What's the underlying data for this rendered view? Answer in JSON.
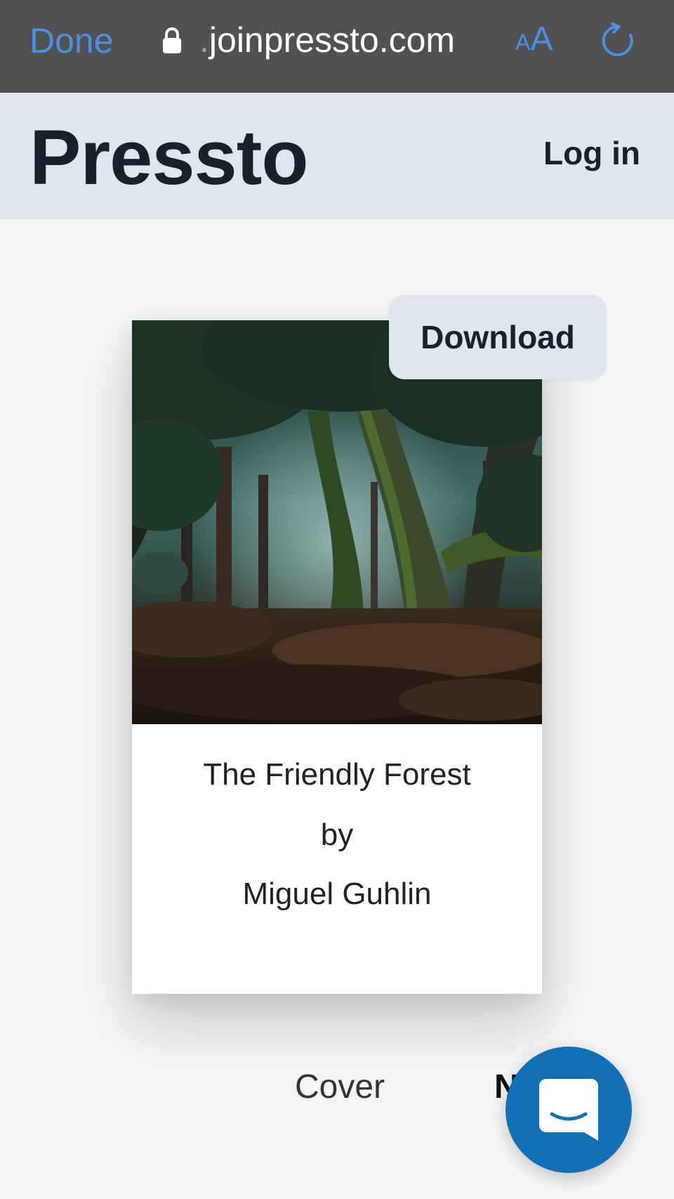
{
  "browser": {
    "done_label": "Done",
    "url_prefix": ".",
    "url": "joinpressto.com",
    "text_size_small": "A",
    "text_size_big": "A",
    "accent_color": "#4a90e2"
  },
  "header": {
    "brand": "Pressto",
    "login_label": "Log in",
    "background_color": "#dfe6ef"
  },
  "book": {
    "download_label": "Download",
    "title": "The Friendly Forest",
    "by": "by",
    "author": "Miguel Guhlin"
  },
  "nav": {
    "cover_label": "Cover",
    "next_label_partial": "N"
  },
  "icons": {
    "lock": "lock-icon",
    "reload": "reload-icon",
    "chat": "chat-icon"
  }
}
